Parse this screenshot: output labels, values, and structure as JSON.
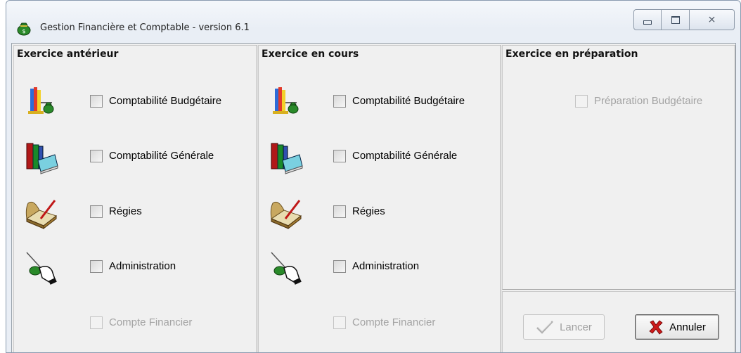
{
  "window": {
    "title": "Gestion Financière et Comptable - version 6.1",
    "minimize_icon": "minimize-icon",
    "maximize_icon": "maximize-icon",
    "close_glyph": "⨯"
  },
  "panels": {
    "anterieur": {
      "title": "Exercice antérieur",
      "items": [
        {
          "label": "Comptabilité Budgétaire",
          "icon": "budget-scale-icon"
        },
        {
          "label": "Comptabilité Générale",
          "icon": "books-icon"
        },
        {
          "label": "Régies",
          "icon": "ledger-pen-icon"
        },
        {
          "label": "Administration",
          "icon": "hand-pointer-icon"
        },
        {
          "label": "Compte Financier",
          "icon": ""
        }
      ]
    },
    "en_cours": {
      "title": "Exercice en cours",
      "items": [
        {
          "label": "Comptabilité Budgétaire",
          "icon": "budget-scale-icon"
        },
        {
          "label": "Comptabilité Générale",
          "icon": "books-icon"
        },
        {
          "label": "Régies",
          "icon": "ledger-pen-icon"
        },
        {
          "label": "Administration",
          "icon": "hand-pointer-icon"
        },
        {
          "label": "Compte Financier",
          "icon": ""
        }
      ]
    },
    "preparation": {
      "title": "Exercice en préparation",
      "items": [
        {
          "label": "Préparation Budgétaire"
        }
      ]
    }
  },
  "buttons": {
    "lancer": "Lancer",
    "annuler": "Annuler"
  },
  "colors": {
    "cancel_x": "#cc1a1a",
    "lancer_check": "#b0b0b0",
    "money_bag": "#1e7a1e"
  }
}
